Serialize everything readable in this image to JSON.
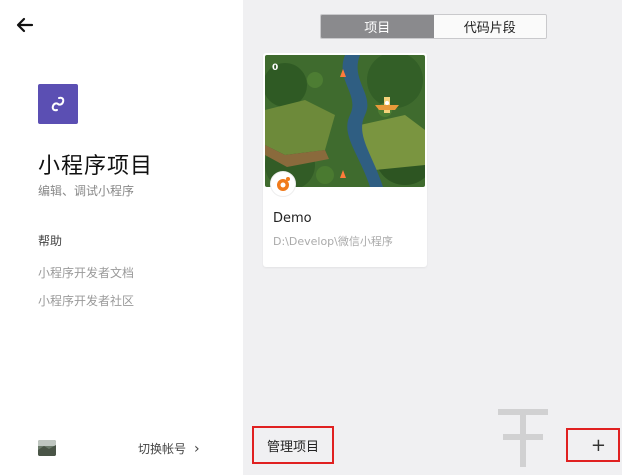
{
  "nav": {
    "back_icon": "arrow-left-icon"
  },
  "sidebar": {
    "logo_icon": "mini-program-logo-icon",
    "logo_color": "#5b4fb3",
    "title": "小程序项目",
    "subtitle": "编辑、调试小程序",
    "help_label": "帮助",
    "links": [
      {
        "label": "小程序开发者文档"
      },
      {
        "label": "小程序开发者社区"
      }
    ],
    "switch_account": {
      "label": "切换帐号",
      "chevron": "›"
    }
  },
  "tabs": [
    {
      "label": "项目",
      "active": true
    },
    {
      "label": "代码片段",
      "active": false
    }
  ],
  "projects": [
    {
      "name": "Demo",
      "path": "D:\\Develop\\微信小程序",
      "thumb_count": "0"
    }
  ],
  "footer": {
    "manage_label": "管理项目",
    "add_label": "+"
  },
  "colors": {
    "accent": "#8a8a8d",
    "highlight_border": "#e02020"
  }
}
